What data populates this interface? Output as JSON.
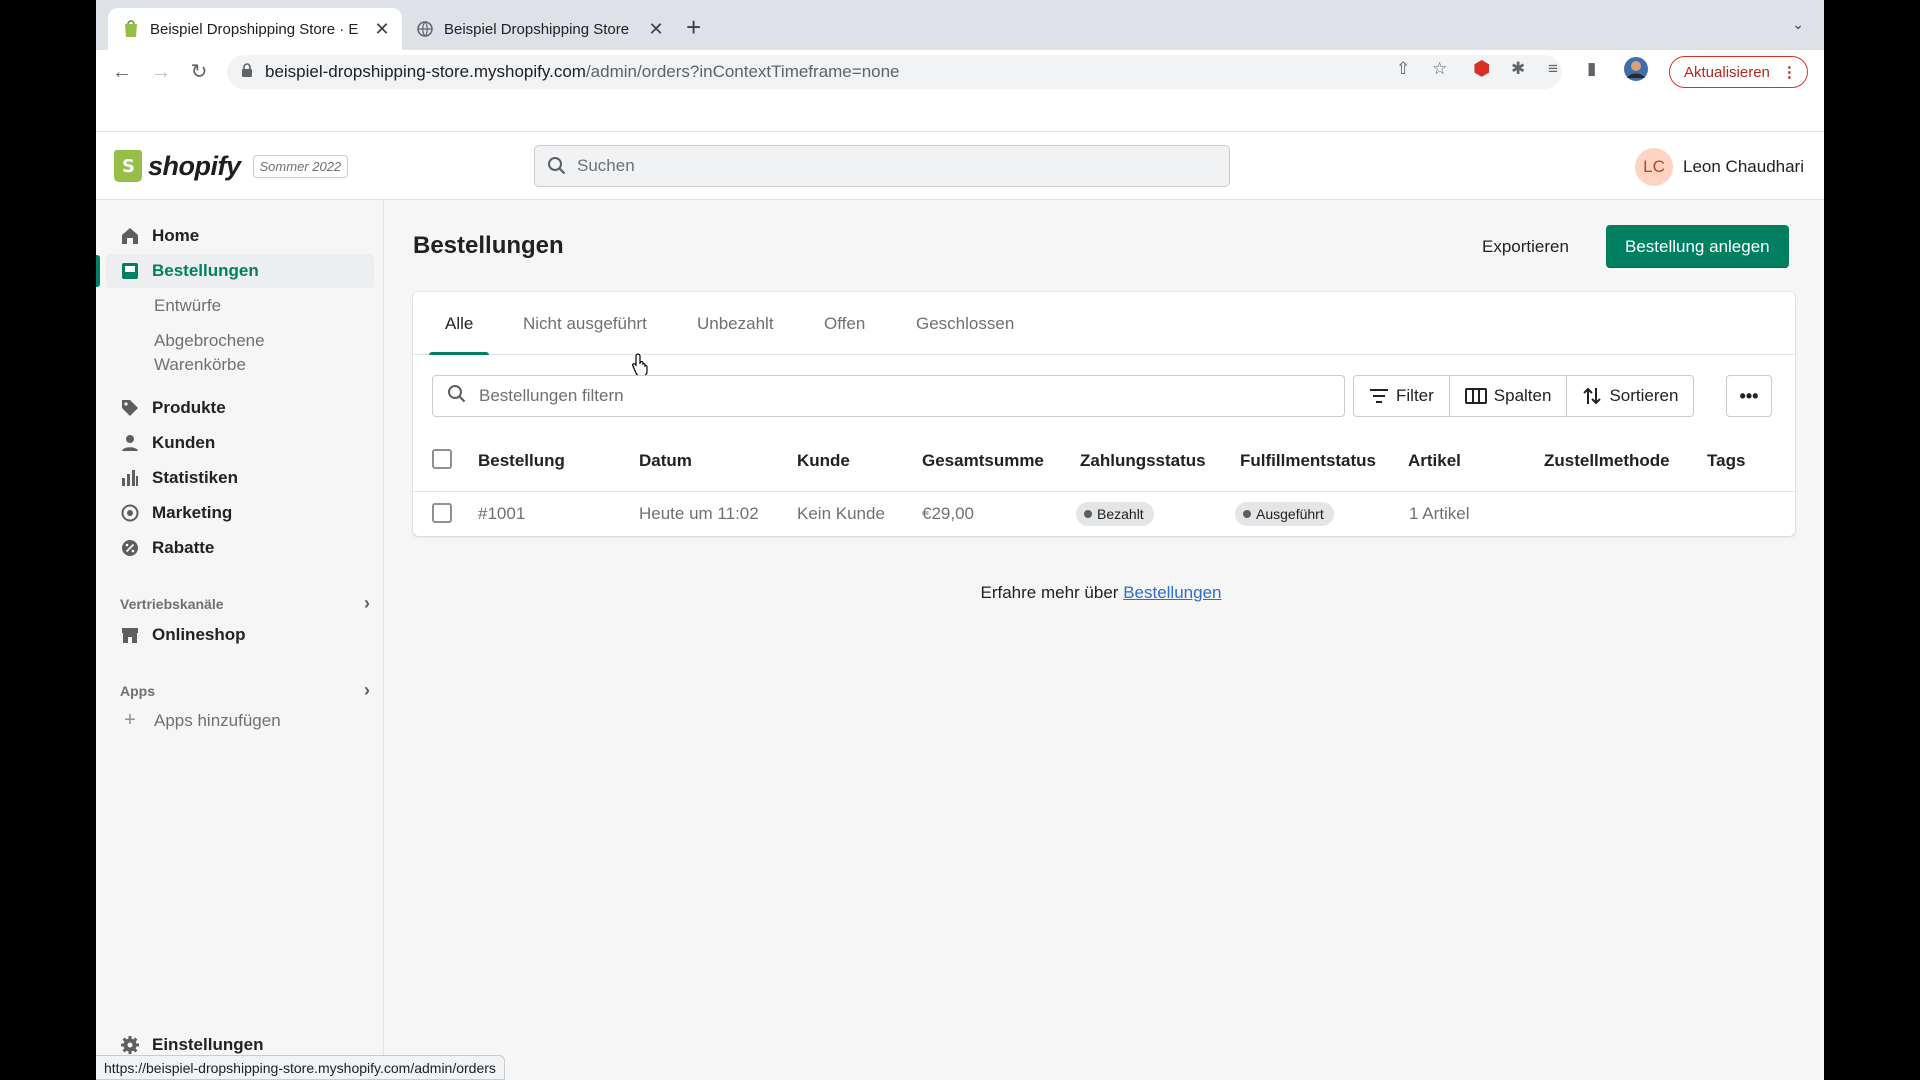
{
  "browser": {
    "tabs": [
      {
        "title": "Beispiel Dropshipping Store · E",
        "active": true
      },
      {
        "title": "Beispiel Dropshipping Store",
        "active": false
      }
    ],
    "url_host": "beispiel-dropshipping-store.myshopify.com",
    "url_path": "/admin/orders?inContextTimeframe=none",
    "update_label": "Aktualisieren",
    "status_url": "https://beispiel-dropshipping-store.myshopify.com/admin/orders"
  },
  "topbar": {
    "logo_text": "shopify",
    "edition": "Sommer 2022",
    "search_placeholder": "Suchen",
    "user_initials": "LC",
    "user_name": "Leon Chaudhari"
  },
  "sidebar": {
    "items": [
      {
        "label": "Home",
        "icon": "home-icon"
      },
      {
        "label": "Bestellungen",
        "icon": "orders-icon"
      },
      {
        "label": "Produkte",
        "icon": "tag-icon"
      },
      {
        "label": "Kunden",
        "icon": "person-icon"
      },
      {
        "label": "Statistiken",
        "icon": "bar-chart-icon"
      },
      {
        "label": "Marketing",
        "icon": "target-icon"
      },
      {
        "label": "Rabatte",
        "icon": "discount-icon"
      }
    ],
    "sub_items": [
      "Entwürfe",
      "Abgebrochene Warenkörbe"
    ],
    "sales_channels_label": "Vertriebskanäle",
    "online_store": "Onlineshop",
    "apps_label": "Apps",
    "add_apps": "Apps hinzufügen",
    "settings": "Einstellungen"
  },
  "main": {
    "title": "Bestellungen",
    "export_label": "Exportieren",
    "create_label": "Bestellung anlegen",
    "tabs": [
      "Alle",
      "Nicht ausgeführt",
      "Unbezahlt",
      "Offen",
      "Geschlossen"
    ],
    "filter_placeholder": "Bestellungen filtern",
    "filter_btn": "Filter",
    "columns_btn": "Spalten",
    "sort_btn": "Sortieren",
    "more_btn": "•••",
    "columns": [
      "Bestellung",
      "Datum",
      "Kunde",
      "Gesamtsumme",
      "Zahlungsstatus",
      "Fulfillmentstatus",
      "Artikel",
      "Zustellmethode",
      "Tags"
    ],
    "rows": [
      {
        "order": "#1001",
        "date": "Heute um 11:02",
        "customer": "Kein Kunde",
        "total": "€29,00",
        "payment": "Bezahlt",
        "fulfillment": "Ausgeführt",
        "items": "1 Artikel"
      }
    ],
    "learn_prefix": "Erfahre mehr über ",
    "learn_link": "Bestellungen"
  },
  "colors": {
    "accent": "#008060",
    "link": "#2c6ecb",
    "update": "#d93025"
  }
}
